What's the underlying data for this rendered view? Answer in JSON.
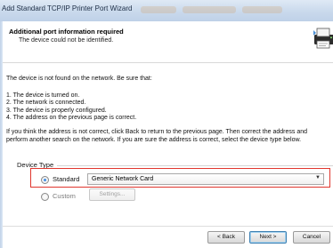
{
  "window": {
    "title": "Add Standard TCP/IP Printer Port Wizard"
  },
  "header": {
    "title": "Additional port information required",
    "subtitle": "The device could not be identified.",
    "icon": "printer-icon"
  },
  "body": {
    "intro": "The device is not found on the network.  Be sure that:",
    "checklist": [
      "1.  The device is turned on.",
      "2.  The network is connected.",
      "3.  The device is properly configured.",
      "4.  The address on the previous page is correct."
    ],
    "paragraph": "If you think the address is not correct, click Back to return to the previous page.  Then correct the address and perform another search on the network.  If you are sure the address is correct, select the device type below."
  },
  "device_type": {
    "label": "Device Type",
    "standard_label": "Standard",
    "standard_selected": true,
    "standard_value": "Generic Network Card",
    "custom_label": "Custom",
    "settings_label": "Settings..."
  },
  "buttons": {
    "back": "< Back",
    "next": "Next >",
    "cancel": "Cancel"
  },
  "colors": {
    "highlight": "#e0362e",
    "radio_accent": "#1a63c2"
  }
}
